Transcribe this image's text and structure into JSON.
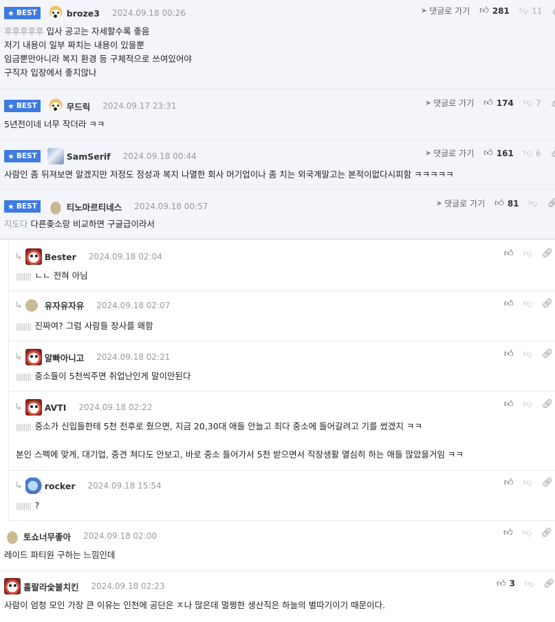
{
  "best_label": "BEST",
  "goto_label": "댓글로 가기",
  "comments": [
    {
      "nick": "broze3",
      "date": "2024.09.18 00:26",
      "likes": "281",
      "dislikes": "11",
      "prefix": "후후후후후",
      "lines": [
        "입사 공고는 자세할수록 좋음",
        "저기 내용이 일부 짜치는 내용이 있을뿐",
        "임금뿐만아니라 복지 환경 등 구체적으로 쓰여있어야",
        "구직자 입장에서 좋지않나"
      ]
    },
    {
      "nick": "무드릭",
      "date": "2024.09.17 23:31",
      "likes": "174",
      "dislikes": "7",
      "lines": [
        "5년전이네 너무 작더라 ㅋㅋ"
      ]
    },
    {
      "nick": "SamSerif",
      "date": "2024.09.18 00:44",
      "likes": "161",
      "dislikes": "6",
      "lines": [
        "사람인 좀 뒤져보면 알겠지만 저정도 정성과 복지 나열한 회사 머기업이나 좀 치는 외국계말고는 본적이없다시피함 ㅋㅋㅋㅋㅋ"
      ]
    },
    {
      "nick": "티노마르티네스",
      "date": "2024.09.18 00:57",
      "likes": "81",
      "prefix": "지도다",
      "lines": [
        "다른좆소랑 비교하면 구글급이라서"
      ]
    }
  ],
  "replies": [
    {
      "nick": "Bester",
      "date": "2024.09.18 02:04",
      "lines": [
        "ㄴㄴ 전혀 아님"
      ]
    },
    {
      "nick": "유자유자유",
      "date": "2024.09.18 02:07",
      "lines": [
        "진짜여? 그럼 사람들 장사를 왜함"
      ]
    },
    {
      "nick": "알빠아니고",
      "date": "2024.09.18 02:21",
      "lines": [
        "중소들이 5천씩주면 취업난인게 말이안된다"
      ]
    },
    {
      "nick": "AVTI",
      "date": "2024.09.18 02:22",
      "lines": [
        "중소가 신입들한테 5천 전후로 줬으면, 지금 20,30대 애들 안늘고 죄다 중소에 들어갈려고 기를 썼겠지 ㅋㅋ",
        "본인 스펙에 맞게, 대기업, 중견 쳐다도 안보고, 바로 중소 들어가서 5천 받으면서 직장생활 열심히 하는 애들 많았을거임 ㅋㅋ"
      ]
    },
    {
      "nick": "rocker",
      "date": "2024.09.18 15:54",
      "lines": [
        "?"
      ]
    }
  ],
  "plain": [
    {
      "nick": "토쇼너무좋아",
      "date": "2024.09.18 02:00",
      "lines": [
        "레이드 파티원 구하는 느낌인데"
      ]
    },
    {
      "nick": "홀랄라숯불치킨",
      "date": "2024.09.18 02:23",
      "likes": "3",
      "lines": [
        "사람이 엄청 모인 가장 큰 이유는 인천에 공단은 ㅈ나 많은데 멀쩡한 생산직은 하늘의 별따기이기 때문이다."
      ]
    }
  ],
  "icons": {
    "star": "star-icon",
    "like": "thumbs-up-icon",
    "dislike": "thumbs-down-icon",
    "link": "link-icon",
    "goto": "arrow-icon",
    "reply": "reply-arrow-icon"
  },
  "colors": {
    "best_badge": "#3d7be3",
    "best_row_bg": "#f3f5fb"
  }
}
